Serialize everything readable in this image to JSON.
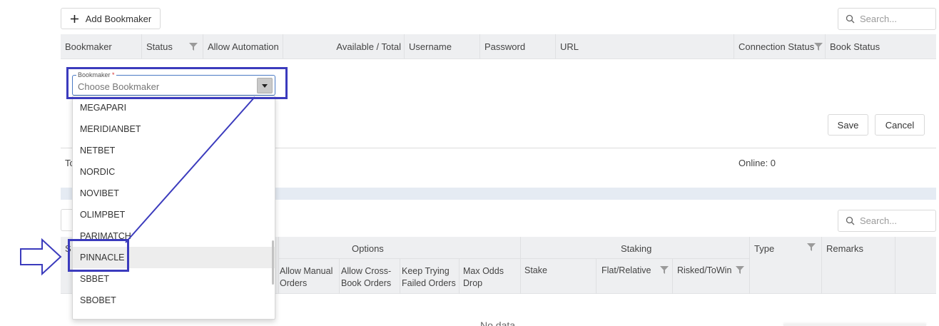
{
  "toolbar": {
    "add_bookmaker_label": "Add Bookmaker",
    "search_placeholder": "Search..."
  },
  "bookmakers_table": {
    "headers": [
      "Bookmaker",
      "Status",
      "Allow Automation",
      "Available / Total",
      "Username",
      "Password",
      "URL",
      "Connection Status",
      "Book Status"
    ]
  },
  "editor": {
    "bookmaker_field_label": "Bookmaker",
    "required_mark": "*",
    "bookmaker_placeholder": "Choose Bookmaker",
    "save_label": "Save",
    "cancel_label": "Cancel"
  },
  "footer": {
    "total_partial": "To",
    "online_label": "Online: 0"
  },
  "dropdown": {
    "items": [
      "MEGAPARI",
      "MERIDIANBET",
      "NETBET",
      "NORDIC",
      "NOVIBET",
      "OLIMPBET",
      "PARIMATCH",
      "PINNACLE",
      "SBBET",
      "SBOBET"
    ],
    "selected": "PINNACLE"
  },
  "second_toolbar": {
    "search_placeholder": "Search..."
  },
  "rules_table": {
    "partial_first_header": "S",
    "group_headers": {
      "options": "Options",
      "staking": "Staking",
      "type": "Type",
      "remarks": "Remarks"
    },
    "sub_headers": {
      "allow_manual_orders": "Allow Manual Orders",
      "allow_cross_book_orders": "Allow Cross-Book Orders",
      "keep_trying_failed_orders": "Keep Trying Failed Orders",
      "max_odds_drop": "Max Odds Drop",
      "stake": "Stake",
      "flat_relative": "Flat/Relative",
      "risked_towin": "Risked/ToWin"
    },
    "empty_text": "No data"
  },
  "annotation": {
    "color": "#3b3bbd"
  }
}
